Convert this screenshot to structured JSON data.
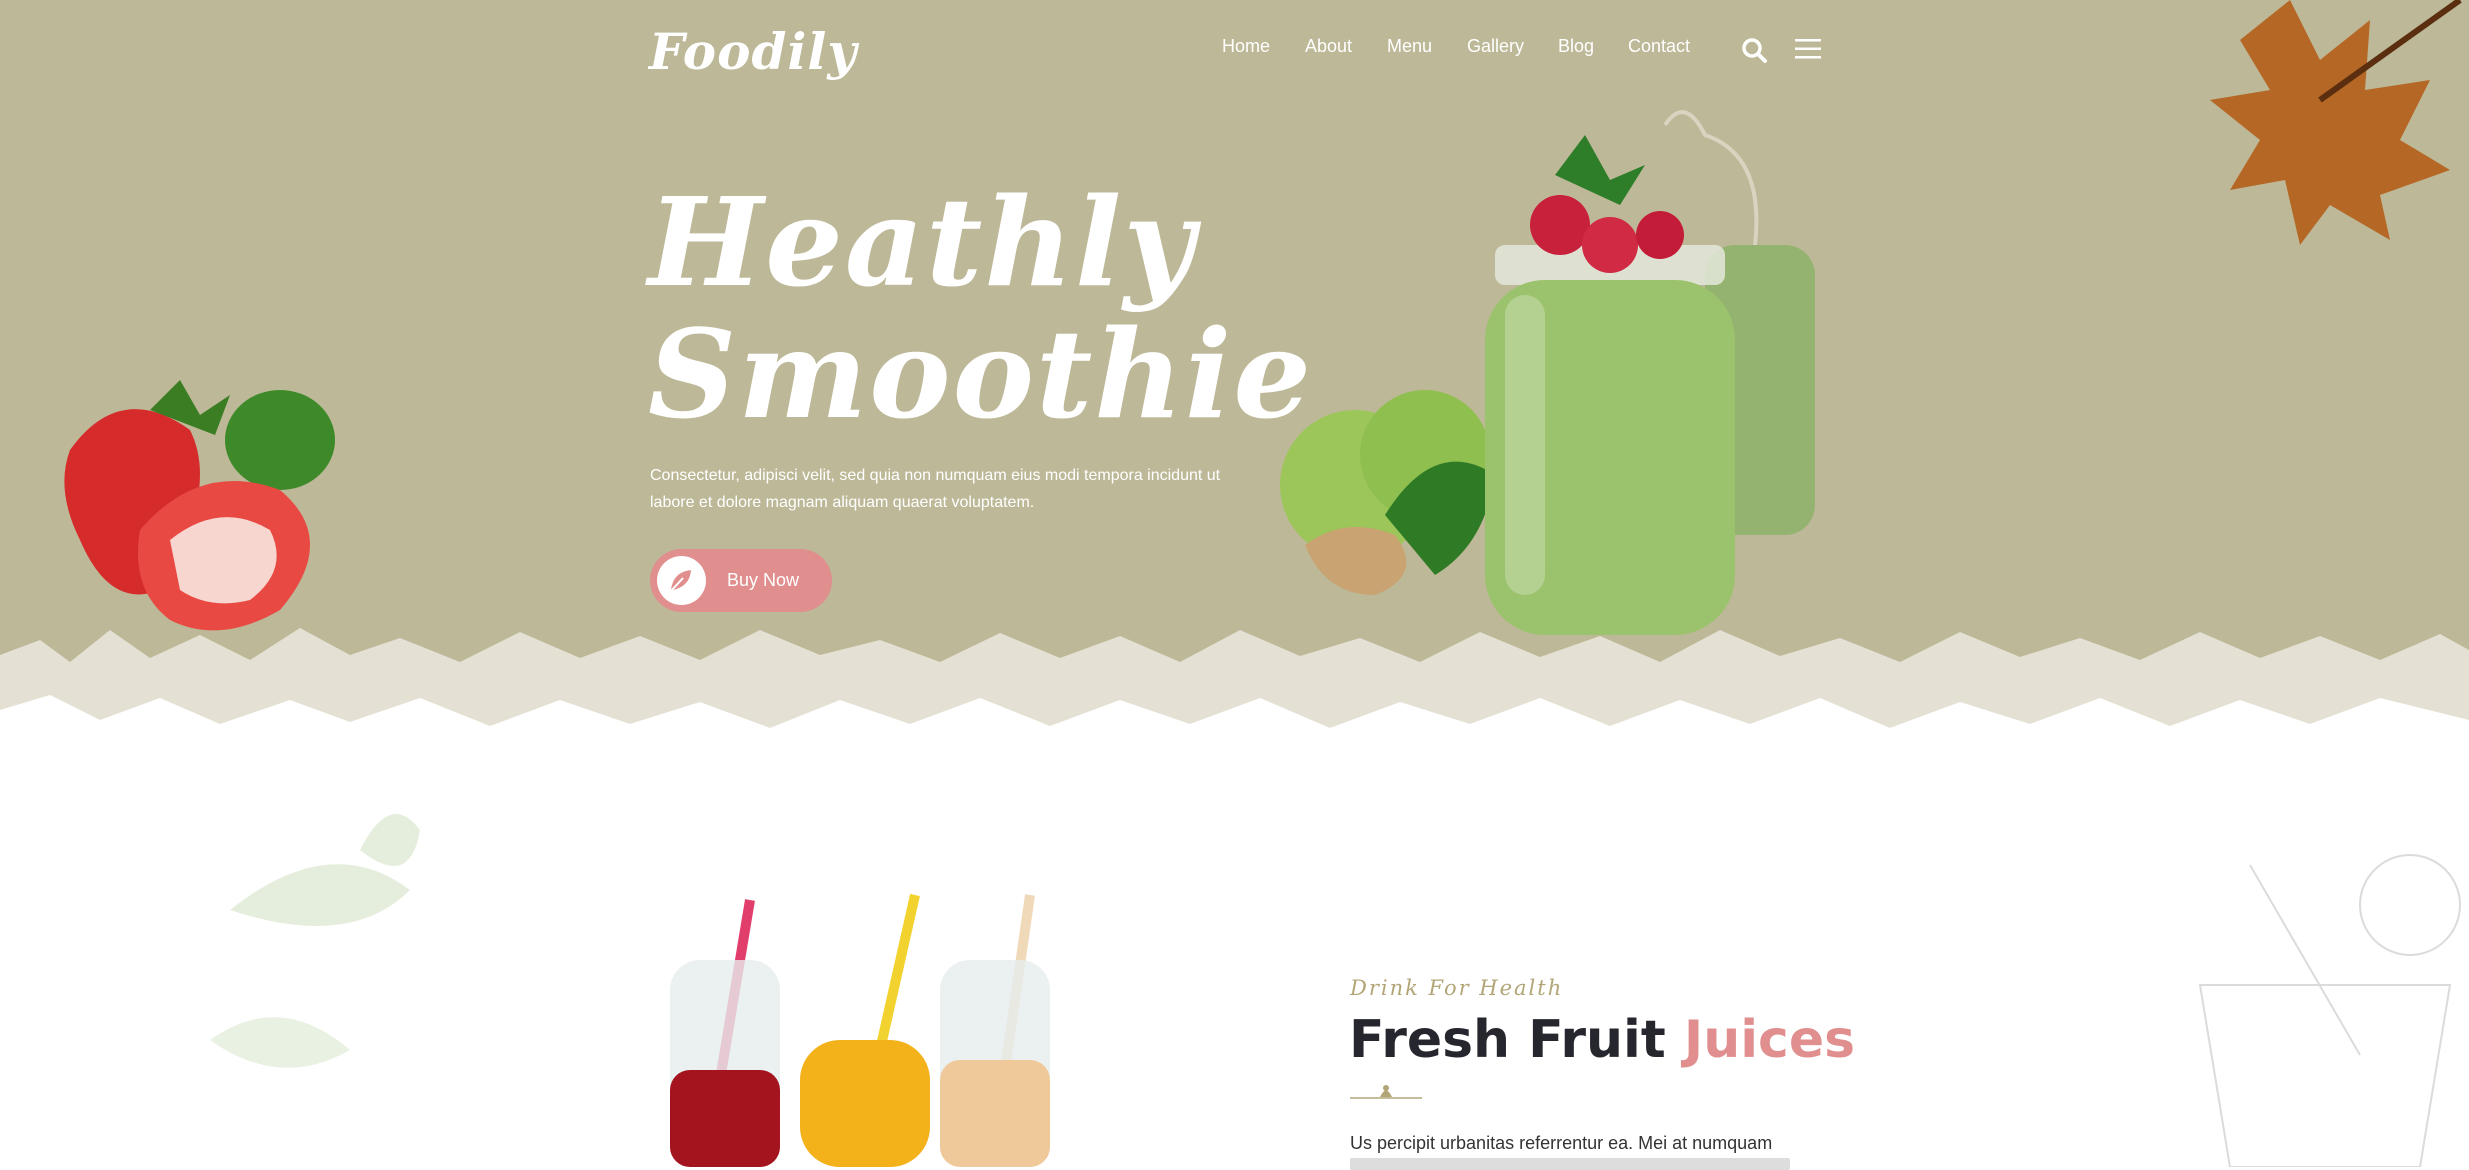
{
  "brand": {
    "logo": "Foodily"
  },
  "nav": {
    "items": [
      "Home",
      "About",
      "Menu",
      "Gallery",
      "Blog",
      "Contact"
    ]
  },
  "icons": {
    "search": "search-icon",
    "menu": "hamburger-menu-icon",
    "button": "leaf-icon"
  },
  "hero": {
    "title_line1": "Heathly",
    "title_line2": "Smoothie",
    "description": "Consectetur, adipisci velit, sed quia non numquam eius modi tempora incidunt ut labore et dolore magnam aliquam quaerat voluptatem.",
    "button_label": "Buy Now"
  },
  "section": {
    "subtitle": "Drink For Health",
    "title_plain": "Fresh Fruit",
    "title_accent": "Juices",
    "body": "Us percipit urbanitas referrentur ea. Mei at numquam"
  },
  "colors": {
    "hero_bg": "#bdb897",
    "accent": "#e08e8e",
    "subtitle": "#b2a577",
    "dark_text": "#26262e"
  }
}
